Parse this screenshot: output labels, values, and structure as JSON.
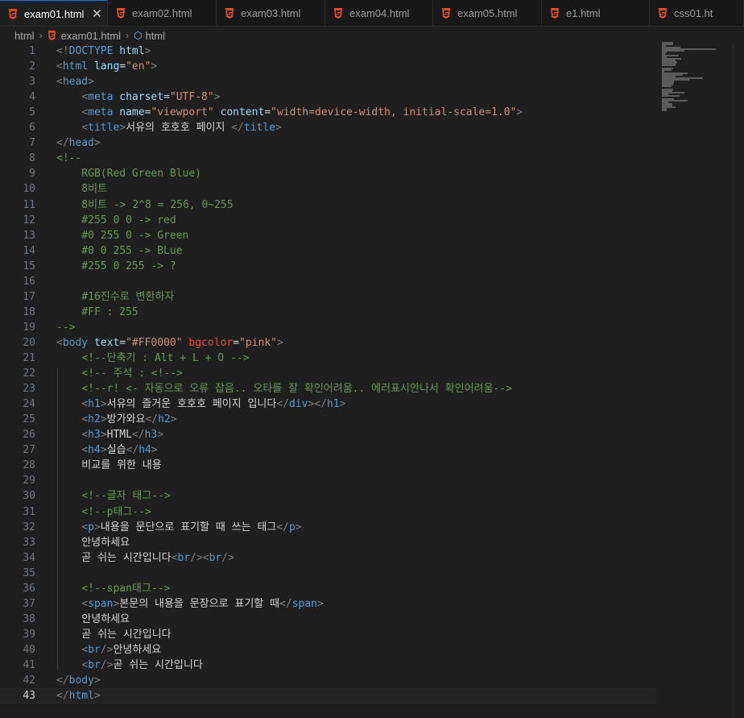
{
  "tabs": [
    {
      "label": "exam01.html",
      "active": true
    },
    {
      "label": "exam02.html"
    },
    {
      "label": "exam03.html"
    },
    {
      "label": "exam04.html"
    },
    {
      "label": "exam05.html"
    },
    {
      "label": "e1.html"
    },
    {
      "label": "css01.ht"
    }
  ],
  "tab_close": "✕",
  "breadcrumb": {
    "folder": "html",
    "file": "exam01.html",
    "symbol": "html"
  },
  "current_line": 43,
  "lines": [
    [
      [
        "t-br",
        "<!"
      ],
      [
        "t-tag",
        "DOCTYPE"
      ],
      [
        "t-txt",
        " "
      ],
      [
        "t-attr",
        "html"
      ],
      [
        "t-br",
        ">"
      ]
    ],
    [
      [
        "t-br",
        "<"
      ],
      [
        "t-tag",
        "html"
      ],
      [
        "t-txt",
        " "
      ],
      [
        "t-attr",
        "lang"
      ],
      [
        "t-txt",
        "="
      ],
      [
        "t-str",
        "\"en\""
      ],
      [
        "t-br",
        ">"
      ]
    ],
    [
      [
        "t-br",
        "<"
      ],
      [
        "t-tag",
        "head"
      ],
      [
        "t-br",
        ">"
      ]
    ],
    [
      [
        "t-txt",
        "    "
      ],
      [
        "t-br",
        "<"
      ],
      [
        "t-tag",
        "meta"
      ],
      [
        "t-txt",
        " "
      ],
      [
        "t-attr",
        "charset"
      ],
      [
        "t-txt",
        "="
      ],
      [
        "t-str",
        "\"UTF-8\""
      ],
      [
        "t-br",
        ">"
      ]
    ],
    [
      [
        "t-txt",
        "    "
      ],
      [
        "t-br",
        "<"
      ],
      [
        "t-tag",
        "meta"
      ],
      [
        "t-txt",
        " "
      ],
      [
        "t-attr",
        "name"
      ],
      [
        "t-txt",
        "="
      ],
      [
        "t-str",
        "\"viewport\""
      ],
      [
        "t-txt",
        " "
      ],
      [
        "t-attr",
        "content"
      ],
      [
        "t-txt",
        "="
      ],
      [
        "t-str",
        "\"width=device-width, initial-scale=1.0\""
      ],
      [
        "t-br",
        ">"
      ]
    ],
    [
      [
        "t-txt",
        "    "
      ],
      [
        "t-br",
        "<"
      ],
      [
        "t-tag",
        "title"
      ],
      [
        "t-br",
        ">"
      ],
      [
        "t-txt",
        "서유의 호호호 페이지 "
      ],
      [
        "t-br",
        "</"
      ],
      [
        "t-tag",
        "title"
      ],
      [
        "t-br",
        ">"
      ]
    ],
    [
      [
        "t-br",
        "</"
      ],
      [
        "t-tag",
        "head"
      ],
      [
        "t-br",
        ">"
      ]
    ],
    [
      [
        "t-cmt",
        "<!--"
      ]
    ],
    [
      [
        "t-cmt",
        "    RGB(Red Green Blue)"
      ]
    ],
    [
      [
        "t-cmt",
        "    8비트"
      ]
    ],
    [
      [
        "t-cmt",
        "    8비트 -> 2^8 = 256, 0~255"
      ]
    ],
    [
      [
        "t-cmt",
        "    #255 0 0 -> red"
      ]
    ],
    [
      [
        "t-cmt",
        "    #0 255 0 -> Green"
      ]
    ],
    [
      [
        "t-cmt",
        "    #0 0 255 -> BLue"
      ]
    ],
    [
      [
        "t-cmt",
        "    #255 0 255 -> ?"
      ]
    ],
    [],
    [
      [
        "t-cmt",
        "    #16진수로 변환하자"
      ]
    ],
    [
      [
        "t-cmt",
        "    #FF : 255"
      ]
    ],
    [
      [
        "t-cmt",
        "-->"
      ]
    ],
    [
      [
        "t-br",
        "<"
      ],
      [
        "t-tag",
        "body"
      ],
      [
        "t-txt",
        " "
      ],
      [
        "t-attr",
        "text"
      ],
      [
        "t-txt",
        "="
      ],
      [
        "t-str",
        "\"#FF0000\""
      ],
      [
        "t-txt",
        " "
      ],
      [
        "t-red",
        "bgcolor"
      ],
      [
        "t-txt",
        "="
      ],
      [
        "t-str",
        "\"pink\""
      ],
      [
        "t-br",
        ">"
      ]
    ],
    [
      [
        "t-txt",
        "    "
      ],
      [
        "t-cmt",
        "<!--단축기 : Alt + L + O -->"
      ]
    ],
    [
      [
        "t-txt",
        "    "
      ],
      [
        "t-cmt",
        "<!-- 주석 : <!-->"
      ]
    ],
    [
      [
        "t-txt",
        "    "
      ],
      [
        "t-cmt",
        "<!--r! <- 자동으로 오류 잡음.. 오타를 잘 확인어려움.. 에러표시안나서 확인어려움-->"
      ]
    ],
    [
      [
        "t-txt",
        "    "
      ],
      [
        "t-br",
        "<"
      ],
      [
        "t-tag",
        "h1"
      ],
      [
        "t-br",
        ">"
      ],
      [
        "t-txt",
        "서유의 즐거운 호호호 페이지 입니다"
      ],
      [
        "t-br",
        "</"
      ],
      [
        "t-tag",
        "div"
      ],
      [
        "t-br",
        "></"
      ],
      [
        "t-tag",
        "h1"
      ],
      [
        "t-br",
        ">"
      ]
    ],
    [
      [
        "t-txt",
        "    "
      ],
      [
        "t-br",
        "<"
      ],
      [
        "t-tag",
        "h2"
      ],
      [
        "t-br",
        ">"
      ],
      [
        "t-txt",
        "방가와요"
      ],
      [
        "t-br",
        "</"
      ],
      [
        "t-tag",
        "h2"
      ],
      [
        "t-br",
        ">"
      ]
    ],
    [
      [
        "t-txt",
        "    "
      ],
      [
        "t-br",
        "<"
      ],
      [
        "t-tag",
        "h3"
      ],
      [
        "t-br",
        ">"
      ],
      [
        "t-txt",
        "HTML"
      ],
      [
        "t-br",
        "</"
      ],
      [
        "t-tag",
        "h3"
      ],
      [
        "t-br",
        ">"
      ]
    ],
    [
      [
        "t-txt",
        "    "
      ],
      [
        "t-br",
        "<"
      ],
      [
        "t-tag",
        "h4"
      ],
      [
        "t-br",
        ">"
      ],
      [
        "t-txt",
        "실습"
      ],
      [
        "t-br",
        "</"
      ],
      [
        "t-tag",
        "h4"
      ],
      [
        "t-br",
        ">"
      ]
    ],
    [
      [
        "t-txt",
        "    비교를 위한 내용"
      ]
    ],
    [],
    [
      [
        "t-txt",
        "    "
      ],
      [
        "t-cmt",
        "<!--글자 태그-->"
      ]
    ],
    [
      [
        "t-txt",
        "    "
      ],
      [
        "t-cmt",
        "<!--p태그-->"
      ]
    ],
    [
      [
        "t-txt",
        "    "
      ],
      [
        "t-br",
        "<"
      ],
      [
        "t-tag",
        "p"
      ],
      [
        "t-br",
        ">"
      ],
      [
        "t-txt",
        "내용을 문단으로 표기할 때 쓰는 태그"
      ],
      [
        "t-br",
        "</"
      ],
      [
        "t-tag",
        "p"
      ],
      [
        "t-br",
        ">"
      ]
    ],
    [
      [
        "t-txt",
        "    안녕하세요"
      ]
    ],
    [
      [
        "t-txt",
        "    곧 쉬는 시간입니다"
      ],
      [
        "t-br",
        "<"
      ],
      [
        "t-tag",
        "br"
      ],
      [
        "t-br",
        "/><"
      ],
      [
        "t-tag",
        "br"
      ],
      [
        "t-br",
        "/>"
      ]
    ],
    [],
    [
      [
        "t-txt",
        "    "
      ],
      [
        "t-cmt",
        "<!--span태그-->"
      ]
    ],
    [
      [
        "t-txt",
        "    "
      ],
      [
        "t-br",
        "<"
      ],
      [
        "t-tag",
        "span"
      ],
      [
        "t-br",
        ">"
      ],
      [
        "t-txt",
        "본문의 내용을 문장으로 표기할 때"
      ],
      [
        "t-br",
        "</"
      ],
      [
        "t-tag",
        "span"
      ],
      [
        "t-br",
        ">"
      ]
    ],
    [
      [
        "t-txt",
        "    안녕하세요"
      ]
    ],
    [
      [
        "t-txt",
        "    곧 쉬는 시간입니다"
      ]
    ],
    [
      [
        "t-txt",
        "    "
      ],
      [
        "t-br",
        "<"
      ],
      [
        "t-tag",
        "br"
      ],
      [
        "t-br",
        "/>"
      ],
      [
        "t-txt",
        "안녕하세요"
      ]
    ],
    [
      [
        "t-txt",
        "    "
      ],
      [
        "t-br",
        "<"
      ],
      [
        "t-tag",
        "br"
      ],
      [
        "t-br",
        "/>"
      ],
      [
        "t-txt",
        "곧 쉬는 시간입니다"
      ]
    ],
    [
      [
        "t-br",
        "</"
      ],
      [
        "t-tag",
        "body"
      ],
      [
        "t-br",
        ">"
      ]
    ],
    [
      [
        "t-br",
        "</"
      ],
      [
        "t-tag",
        "html"
      ],
      [
        "t-br",
        ">"
      ]
    ]
  ],
  "colors": {
    "tag": "#569cd6",
    "attribute": "#9cdcfe",
    "string": "#ce9178",
    "comment": "#6a9955",
    "text": "#d4d4d4",
    "editor_bg": "#1f1f1f"
  },
  "icons": {
    "tab_file": "html5-icon",
    "breadcrumb_symbol": "symbol-cube-icon"
  }
}
